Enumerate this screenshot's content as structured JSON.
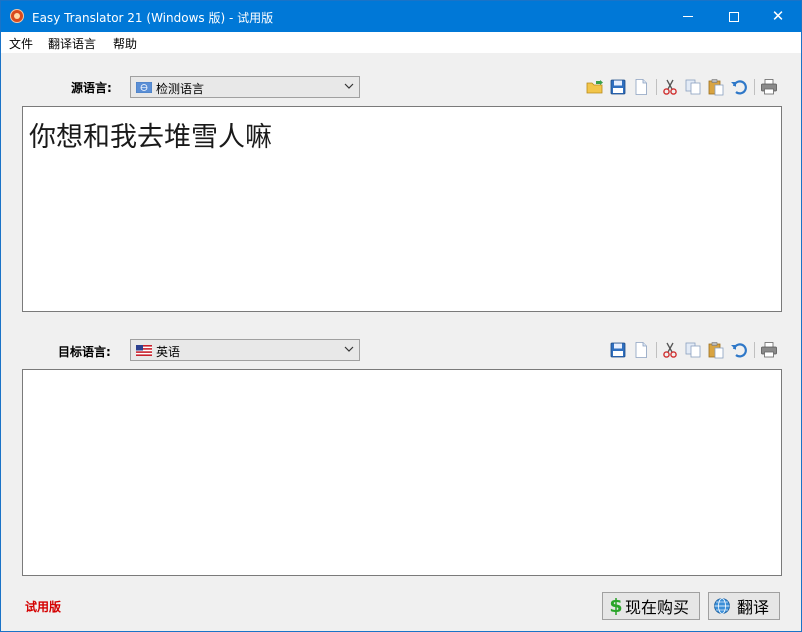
{
  "window": {
    "title": "Easy Translator 21 (Windows 版) - 试用版"
  },
  "menu": {
    "items": [
      "文件",
      "翻译语言",
      "帮助"
    ]
  },
  "source": {
    "label": "源语言:",
    "language": "检测语言",
    "text": "你想和我去堆雪人嘛"
  },
  "target": {
    "label": "目标语言:",
    "language": "英语",
    "text": ""
  },
  "toolbar_icons": {
    "source": [
      "open-folder-icon",
      "save-icon",
      "new-document-icon",
      "cut-icon",
      "copy-icon",
      "paste-icon",
      "undo-icon",
      "print-icon"
    ],
    "target": [
      "save-icon",
      "new-document-icon",
      "cut-icon",
      "copy-icon",
      "paste-icon",
      "undo-icon",
      "print-icon"
    ]
  },
  "footer": {
    "trial_label": "试用版",
    "buy_label": "现在购买",
    "translate_label": "翻译"
  },
  "colors": {
    "titlebar": "#0078d7",
    "trial_text": "#d40000",
    "dollar": "#2aa52a"
  }
}
